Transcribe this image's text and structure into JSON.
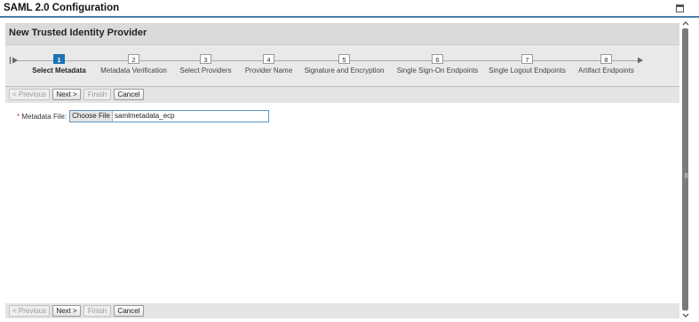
{
  "window": {
    "title": "SAML 2.0 Configuration"
  },
  "panel": {
    "title": "New Trusted Identity Provider"
  },
  "roadmap": {
    "steps": [
      {
        "number": "1",
        "label": "Select Metadata",
        "active": true
      },
      {
        "number": "2",
        "label": "Metadata Verification",
        "active": false
      },
      {
        "number": "3",
        "label": "Select Providers",
        "active": false
      },
      {
        "number": "4",
        "label": "Provider Name",
        "active": false
      },
      {
        "number": "5",
        "label": "Signature and Encryption",
        "active": false
      },
      {
        "number": "6",
        "label": "Single Sign-On Endpoints",
        "active": false
      },
      {
        "number": "7",
        "label": "Single Logout Endpoints",
        "active": false
      },
      {
        "number": "8",
        "label": "Artifact Endpoints",
        "active": false
      }
    ]
  },
  "toolbar": {
    "previous_label": "< Previous",
    "next_label": "Next >",
    "finish_label": "Finish",
    "cancel_label": "Cancel",
    "previous_enabled": false,
    "next_enabled": true,
    "finish_enabled": false,
    "cancel_enabled": true
  },
  "form": {
    "required_marker": "*",
    "metadata_label": "Metadata File:",
    "choose_file_label": "Choose File",
    "file_name": "samlmetadata_ecp"
  },
  "colors": {
    "accent": "#4f7ea8",
    "active_step": "#1e73b4",
    "header_bg": "#dadada",
    "roadmap_bg": "#e9e9e9",
    "toolbar_bg": "#e4e4e4"
  },
  "icons": {
    "maximize": "maximize-icon",
    "roadmap_start": "roadmap-start-icon",
    "roadmap_end": "roadmap-end-icon",
    "scroll_up": "chevron-up-icon",
    "scroll_down": "chevron-down-icon"
  }
}
